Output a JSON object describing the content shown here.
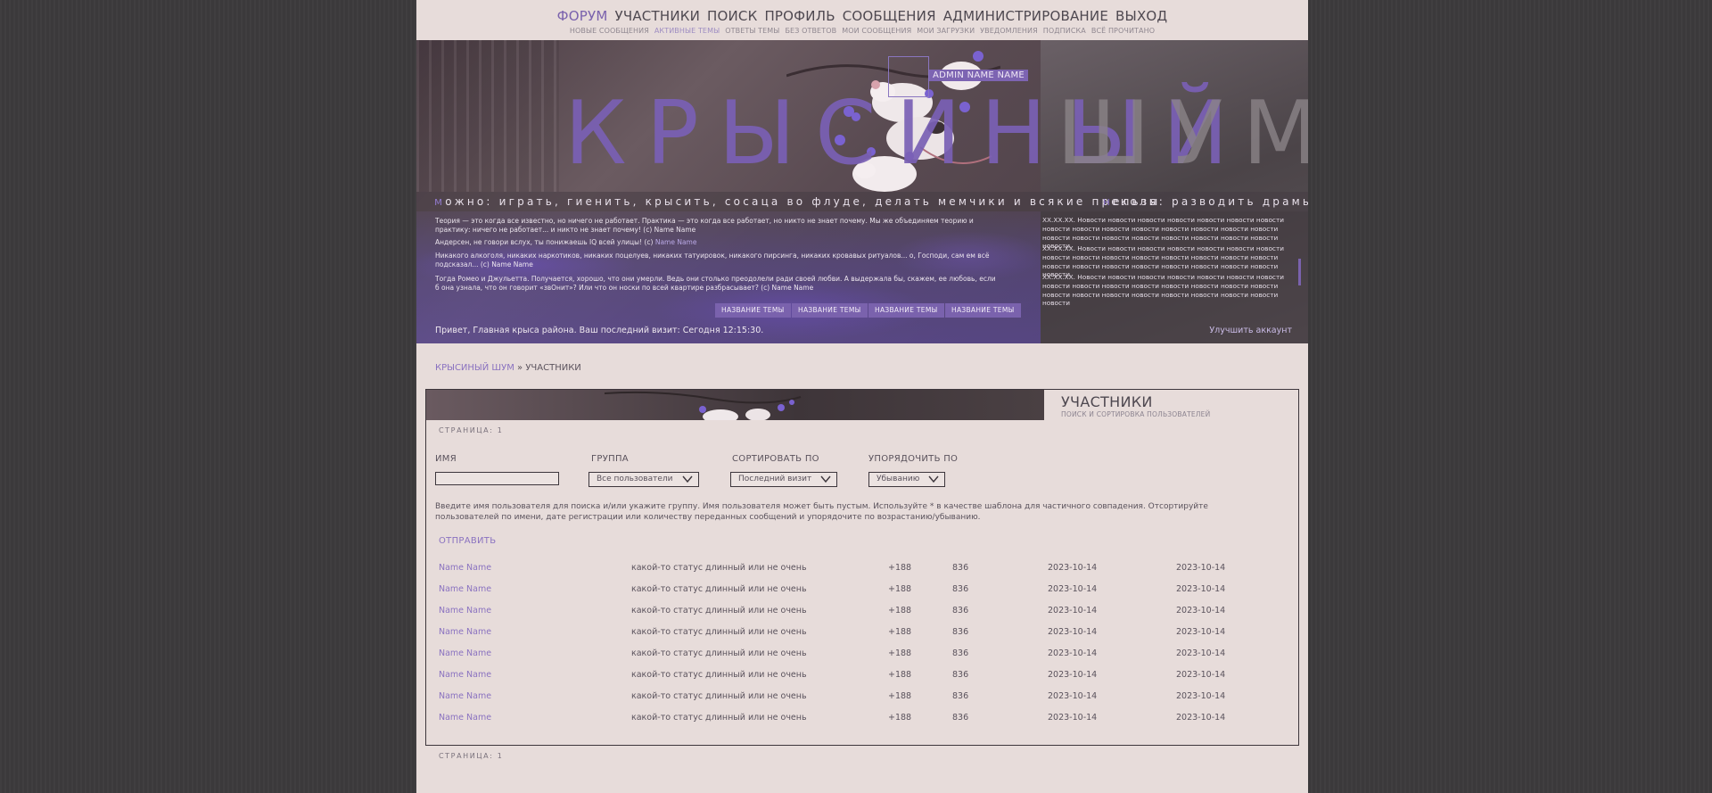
{
  "nav": {
    "main": [
      "ФОРУМ",
      "УЧАСТНИКИ",
      "ПОИСК",
      "ПРОФИЛЬ",
      "СООБЩЕНИЯ",
      "АДМИНИСТРИРОВАНИЕ",
      "ВЫХОД"
    ],
    "sub": [
      "НОВЫЕ СООБЩЕНИЯ",
      "АКТИВНЫЕ ТЕМЫ",
      "ОТВЕТЫ ТЕМЫ",
      "БЕЗ ОТВЕТОВ",
      "МОИ СООБЩЕНИЯ",
      "МОИ ЗАГРУЗКИ",
      "УВЕДОМЛЕНИЯ",
      "ПОДПИСКА",
      "ВСЁ ПРОЧИТАНО"
    ]
  },
  "banner": {
    "title_word1": "КРЫСИНЫЙ",
    "title_word2": "ШУМ",
    "admin_name": "ADMIN NAME NAME",
    "tagline_can_initial": "м",
    "tagline_can": "ожно: играть, гиенить, крысить, сосаца во флуде, делать мемчики и всякие преколы",
    "tagline_cannot_initial": "н",
    "tagline_cannot": "ельзя: разводить драмы",
    "quotes": [
      {
        "text": "Теория — это когда все известно, но ничего не работает. Практика — это когда все работает, но никто не знает почему. Мы же объединяем теорию и практику: ничего не работает... и никто не знает почему! (с) Name Name",
        "name": ""
      },
      {
        "text": "Андерсен, не говори вслух, ты понижаешь IQ всей улицы! (с) ",
        "name": "Name Name"
      },
      {
        "text": "Никакого алкоголя, никаких наркотиков, никаких поцелуев, никаких татуировок, никакого пирсинга, никаких кровавых ритуалов... о, Господи, сам ем всё подсказал... (с) Name Name",
        "name": ""
      },
      {
        "text": "Тогда Ромео и Джульетта. Получается, хорошо, что они умерли. Ведь они столько преодолели ради своей любви. А выдержала бы, скажем, ее любовь, если б она узнала, что он говорит «звОнит»? Или что он носки по всей квартире разбрасывает? (с) Name Name",
        "name": ""
      }
    ],
    "topic_buttons": [
      "НАЗВАНИЕ ТЕМЫ",
      "НАЗВАНИЕ ТЕМЫ",
      "НАЗВАНИЕ ТЕМЫ",
      "НАЗВАНИЕ ТЕМЫ"
    ],
    "news": [
      "XX.XX.XX. Новости новости новости новости новости новости новости новости новости новости новости новости новости новости новости новости новости новости новости новости новости новости новости новости",
      "XX.XX.XX. Новости новости новости новости новости новости новости новости новости новости новости новости новости новости новости новости новости новости новости новости новости новости новости новости",
      "XX.XX.XX. Новости новости новости новости новости новости новости новости новости новости новости новости новости новости новости новости новости новости новости новости новости новости новости новости"
    ],
    "welcome": "Привет, Главная крыса района. Ваш последний визит: Сегодня 12:15:30.",
    "improve": "Улучшить аккаунт"
  },
  "breadcrumb": {
    "home": "КРЫСИНЫЙ ШУМ",
    "sep": " » ",
    "current": "УЧАСТНИКИ"
  },
  "panel": {
    "title": "УЧАСТНИКИ",
    "subtitle": "ПОИСК И СОРТИРОВКА ПОЛЬЗОВАТЕЛЕЙ",
    "page_top": "СТРАНИЦА: 1",
    "page_bottom": "СТРАНИЦА: 1",
    "labels": {
      "name": "ИМЯ",
      "group": "ГРУППА",
      "sort": "СОРТИРОВАТЬ ПО",
      "order": "УПОРЯДОЧИТЬ ПО"
    },
    "values": {
      "name": "",
      "group": "Все пользователи",
      "sort": "Последний визит",
      "order": "Убыванию"
    },
    "help": "Введите имя пользователя для поиска и/или укажите группу. Имя пользователя может быть пустым. Используйте * в качестве шаблона для частичного совпадения. Отсортируйте пользователей по имени, дате регистрации или количеству переданных сообщений и упорядочите по возрастанию/убыванию.",
    "submit": "ОТПРАВИТЬ"
  },
  "users": [
    {
      "name": "Name Name",
      "status": "какой-то статус длинный или не очень",
      "rep": "+188",
      "posts": "836",
      "registered": "2023-10-14",
      "last_visit": "2023-10-14"
    },
    {
      "name": "Name Name",
      "status": "какой-то статус длинный или не очень",
      "rep": "+188",
      "posts": "836",
      "registered": "2023-10-14",
      "last_visit": "2023-10-14"
    },
    {
      "name": "Name Name",
      "status": "какой-то статус длинный или не очень",
      "rep": "+188",
      "posts": "836",
      "registered": "2023-10-14",
      "last_visit": "2023-10-14"
    },
    {
      "name": "Name Name",
      "status": "какой-то статус длинный или не очень",
      "rep": "+188",
      "posts": "836",
      "registered": "2023-10-14",
      "last_visit": "2023-10-14"
    },
    {
      "name": "Name Name",
      "status": "какой-то статус длинный или не очень",
      "rep": "+188",
      "posts": "836",
      "registered": "2023-10-14",
      "last_visit": "2023-10-14"
    },
    {
      "name": "Name Name",
      "status": "какой-то статус длинный или не очень",
      "rep": "+188",
      "posts": "836",
      "registered": "2023-10-14",
      "last_visit": "2023-10-14"
    },
    {
      "name": "Name Name",
      "status": "какой-то статус длинный или не очень",
      "rep": "+188",
      "posts": "836",
      "registered": "2023-10-14",
      "last_visit": "2023-10-14"
    },
    {
      "name": "Name Name",
      "status": "какой-то статус длинный или не очень",
      "rep": "+188",
      "posts": "836",
      "registered": "2023-10-14",
      "last_visit": "2023-10-14"
    }
  ],
  "colors": {
    "accent": "#7a62ad",
    "page": "#e7dcda",
    "body_bg": "#3b393b"
  }
}
